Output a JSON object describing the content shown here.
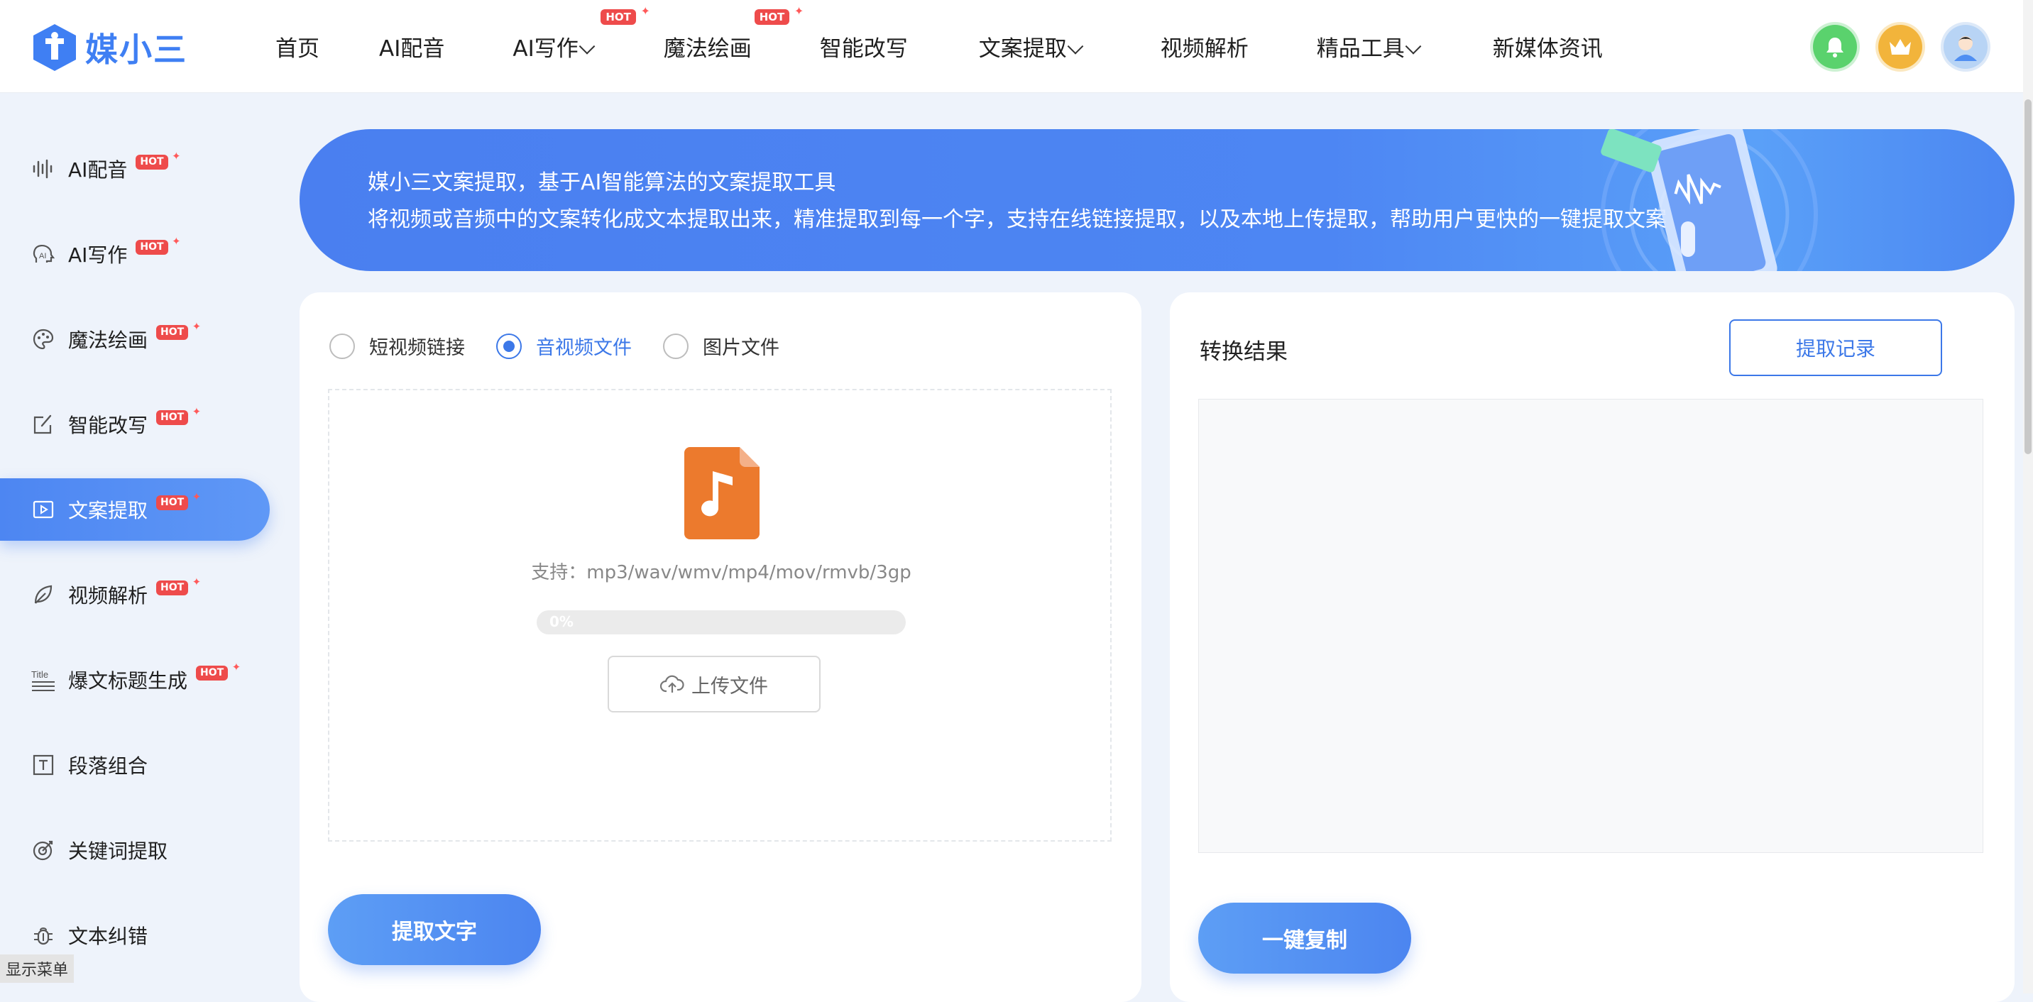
{
  "brand": {
    "name": "媒小三",
    "color": "#3f7ff3"
  },
  "nav": {
    "items": [
      {
        "label": "首页",
        "hot": false,
        "dropdown": false
      },
      {
        "label": "AI配音",
        "hot": false,
        "dropdown": false
      },
      {
        "label": "AI写作",
        "hot": true,
        "dropdown": true
      },
      {
        "label": "魔法绘画",
        "hot": true,
        "dropdown": false
      },
      {
        "label": "智能改写",
        "hot": false,
        "dropdown": false
      },
      {
        "label": "文案提取",
        "hot": false,
        "dropdown": true
      },
      {
        "label": "视频解析",
        "hot": false,
        "dropdown": false
      },
      {
        "label": "精品工具",
        "hot": false,
        "dropdown": true
      },
      {
        "label": "新媒体资讯",
        "hot": false,
        "dropdown": false
      }
    ],
    "hot_label": "HOT"
  },
  "top_icons": [
    "bell-icon",
    "crown-icon",
    "avatar-icon"
  ],
  "sidebar": {
    "items": [
      {
        "label": "AI配音",
        "hot": true,
        "icon": "waveform-icon"
      },
      {
        "label": "AI写作",
        "hot": true,
        "icon": "ai-head-icon"
      },
      {
        "label": "魔法绘画",
        "hot": true,
        "icon": "palette-icon"
      },
      {
        "label": "智能改写",
        "hot": true,
        "icon": "edit-icon"
      },
      {
        "label": "文案提取",
        "hot": true,
        "icon": "video-play-icon",
        "active": true
      },
      {
        "label": "视频解析",
        "hot": true,
        "icon": "leaf-icon"
      },
      {
        "label": "爆文标题生成",
        "hot": true,
        "icon": "title-icon"
      },
      {
        "label": "段落组合",
        "hot": false,
        "icon": "text-box-icon"
      },
      {
        "label": "关键词提取",
        "hot": false,
        "icon": "target-icon"
      },
      {
        "label": "文本纠错",
        "hot": false,
        "icon": "bug-icon"
      }
    ],
    "hot_label": "HOT",
    "show_menu": "显示菜单"
  },
  "banner": {
    "line1": "媒小三文案提取，基于AI智能算法的文案提取工具",
    "line2": "将视频或音频中的文案转化成文本提取出来，精准提取到每一个字，支持在线链接提取，以及本地上传提取，帮助用户更快的一键提取文案"
  },
  "extract_panel": {
    "options": [
      {
        "label": "短视频链接",
        "checked": false
      },
      {
        "label": "音视频文件",
        "checked": true
      },
      {
        "label": "图片文件",
        "checked": false
      }
    ],
    "support_text": "支持：mp3/wav/wmv/mp4/mov/rmvb/3gp",
    "progress": {
      "label": "0%",
      "value": 0
    },
    "upload_label": "上传文件",
    "extract_label": "提取文字"
  },
  "result_panel": {
    "title": "转换结果",
    "records_label": "提取记录",
    "copy_label": "一键复制",
    "content": ""
  },
  "colors": {
    "accent": "#3c78e8",
    "hot": "#ee4b4b",
    "file_icon": "#ec7a2d"
  }
}
